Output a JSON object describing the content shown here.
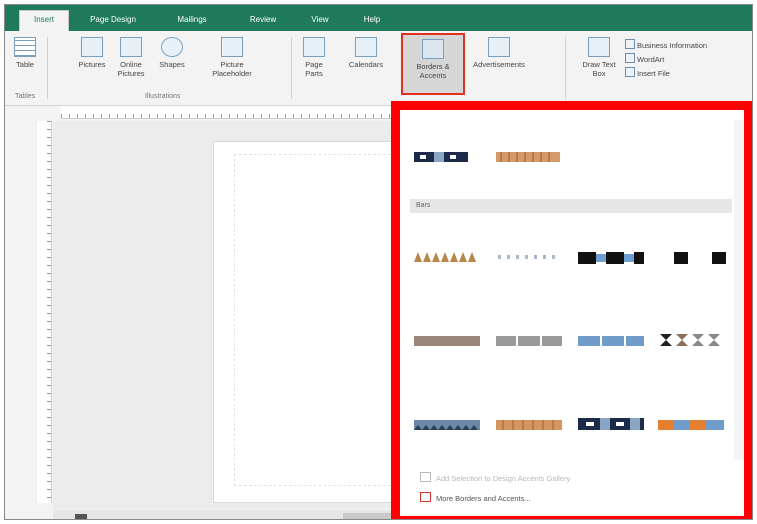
{
  "tabs": [
    {
      "label": "Insert",
      "active": true
    },
    {
      "label": "Page Design"
    },
    {
      "label": "Mailings"
    },
    {
      "label": "Review"
    },
    {
      "label": "View"
    },
    {
      "label": "Help"
    }
  ],
  "ribbon": {
    "table": "Table",
    "pictures": "Pictures",
    "online_pictures": "Online Pictures",
    "shapes": "Shapes",
    "picture_placeholder": "Picture Placeholder",
    "page_parts": "Page Parts",
    "calendars": "Calendars",
    "borders_accents": "Borders & Accents",
    "advertisements": "Advertisements",
    "draw_text_box": "Draw Text Box",
    "business_info": "Business Information",
    "wordart": "WordArt",
    "insert_file": "Insert File",
    "group_tables": "Tables",
    "group_illustrations": "Illustrations"
  },
  "dropdown": {
    "section_bars": "Bars",
    "footer_add": "Add Selection to Design Accents Gallery",
    "footer_more": "More Borders and Accents..."
  },
  "colors": {
    "ribbon_green": "#1f7a5c",
    "highlight_red": "#ff0000"
  }
}
